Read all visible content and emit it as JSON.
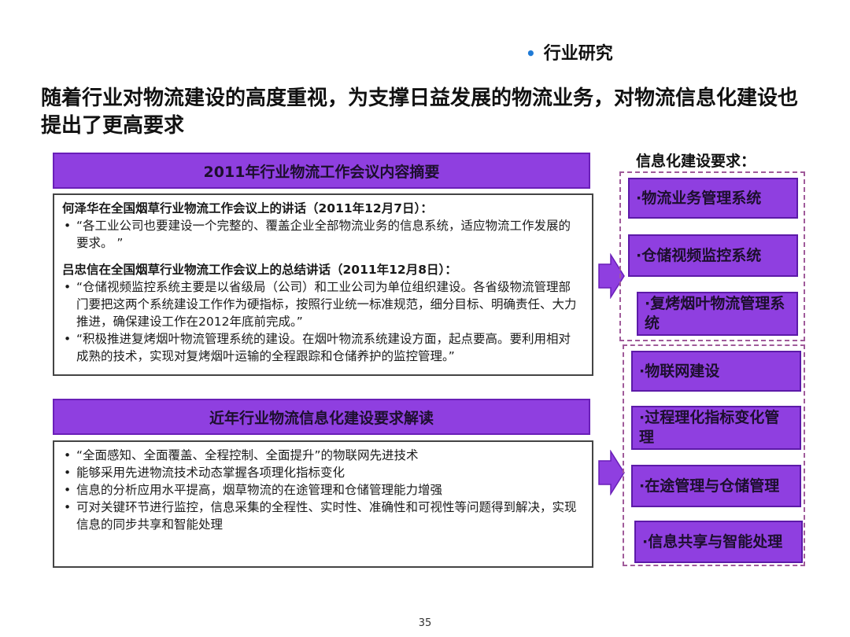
{
  "header": {
    "section_tag": "行业研究",
    "title": "随着行业对物流建设的高度重视，为支撑日益发展的物流业务，对物流信息化建设也提出了更高要求"
  },
  "summary_section": {
    "heading": "2011年行业物流工作会议内容摘要",
    "speeches": [
      {
        "speaker": "何泽华在全国烟草行业物流工作会议上的讲话（2011年12月7日）：",
        "bullets": [
          "“各工业公司也要建设一个完整的、覆盖企业全部物流业务的信息系统，适应物流工作发展的要求。 ”"
        ]
      },
      {
        "speaker": "吕忠信在全国烟草行业物流工作会议上的总结讲话（2011年12月8日）：",
        "bullets": [
          "“仓储视频监控系统主要是以省级局（公司）和工业公司为单位组织建设。各省级物流管理部门要把这两个系统建设工作作为硬指标，按照行业统一标准规范，细分目标、明确责任、大力推进，确保建设工作在2012年底前完成。”",
          "“积极推进复烤烟叶物流管理系统的建设。在烟叶物流系统建设方面，起点要高。要利用相对成熟的技术，实现对复烤烟叶运输的全程跟踪和仓储养护的监控管理。”"
        ]
      }
    ]
  },
  "interpretation_section": {
    "heading": "近年行业物流信息化建设要求解读",
    "bullets": [
      "“全面感知、全面覆盖、全程控制、全面提升”的物联网先进技术",
      "能够采用先进物流技术动态掌握各项理化指标变化",
      "信息的分析应用水平提高，烟草物流的在途管理和仓储管理能力增强",
      "可对关键环节进行监控，信息采集的全程性、实时性、准确性和可视性等问题得到解决，实现信息的同步共享和智能处理"
    ]
  },
  "requirements": {
    "title": "信息化建设要求：",
    "group1": [
      "物流业务管理系统",
      "仓储视频监控系统",
      "复烤烟叶物流管理系统"
    ],
    "group2": [
      "物联网建设",
      "过程理化指标变化管理",
      "在途管理与仓储管理",
      "信息共享与智能处理"
    ]
  },
  "footer": {
    "page_number": "35"
  },
  "colors": {
    "purple": "#8f3fe0",
    "purple_border": "#5c1aa8",
    "dash": "#a05b9a",
    "tag_dot": "#1f7ad6"
  }
}
